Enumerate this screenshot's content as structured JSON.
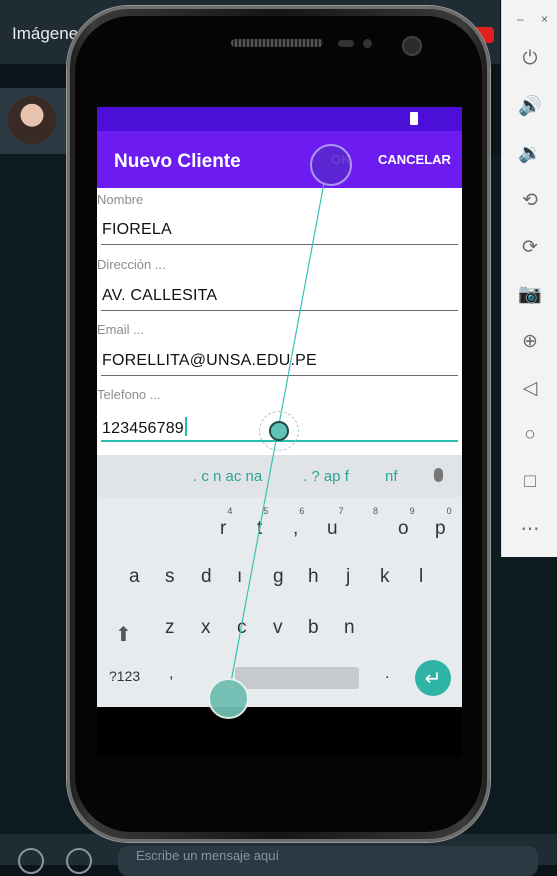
{
  "background_app": {
    "title": "Imágene",
    "input_placeholder": "Escribe un mensaje aquí"
  },
  "emulator_panel": {
    "top_controls": [
      "–",
      "×"
    ],
    "buttons": [
      {
        "icon": "power-icon",
        "glyph": "⏻"
      },
      {
        "icon": "volume-up-icon",
        "glyph": "🔊"
      },
      {
        "icon": "volume-down-icon",
        "glyph": "🔉"
      },
      {
        "icon": "rotate-left-icon",
        "glyph": "⟲"
      },
      {
        "icon": "rotate-right-icon",
        "glyph": "⟳"
      },
      {
        "icon": "camera-icon",
        "glyph": "📷"
      },
      {
        "icon": "zoom-in-icon",
        "glyph": "⊕"
      },
      {
        "icon": "back-icon",
        "glyph": "◁"
      },
      {
        "icon": "home-icon",
        "glyph": "○"
      },
      {
        "icon": "overview-icon",
        "glyph": "□"
      },
      {
        "icon": "more-icon",
        "glyph": "⋯"
      }
    ]
  },
  "app": {
    "title": "Nuevo Cliente",
    "ok_label": "OK",
    "cancel_label": "CANCELAR",
    "colors": {
      "appbar": "#6c1cf0",
      "status": "#4c0fd8",
      "accent": "#26bfad"
    }
  },
  "form": {
    "nombre_label": "Nombre",
    "nombre_value": "FIORELA",
    "direccion_label": "Dirección ...",
    "direccion_value": "AV. CALLESITA",
    "email_label": "Email ...",
    "email_value": "FORELLITA@UNSA.EDU.PE",
    "telefono_label": "Telefono ...",
    "telefono_value": "123456789"
  },
  "keyboard": {
    "suggestions": [
      ". c n ac na",
      ". ?  ap f",
      "nf"
    ],
    "row1": [
      {
        "k": "r",
        "h": "4"
      },
      {
        "k": "t",
        "h": "5"
      },
      {
        "k": ",",
        "h": "6"
      },
      {
        "k": "u",
        "h": "7"
      },
      {
        "k": "",
        "h": "8"
      },
      {
        "k": "o",
        "h": "9"
      },
      {
        "k": "p",
        "h": "0"
      }
    ],
    "row2": [
      "a",
      "s",
      "d",
      "ı",
      "g",
      "h",
      "j",
      "k",
      "l"
    ],
    "row3": [
      "z",
      "x",
      "c",
      "v",
      "b",
      "n"
    ],
    "symbols_label": "?123",
    "comma_label": ",",
    "period_label": ".",
    "enter_glyph": "↵"
  }
}
